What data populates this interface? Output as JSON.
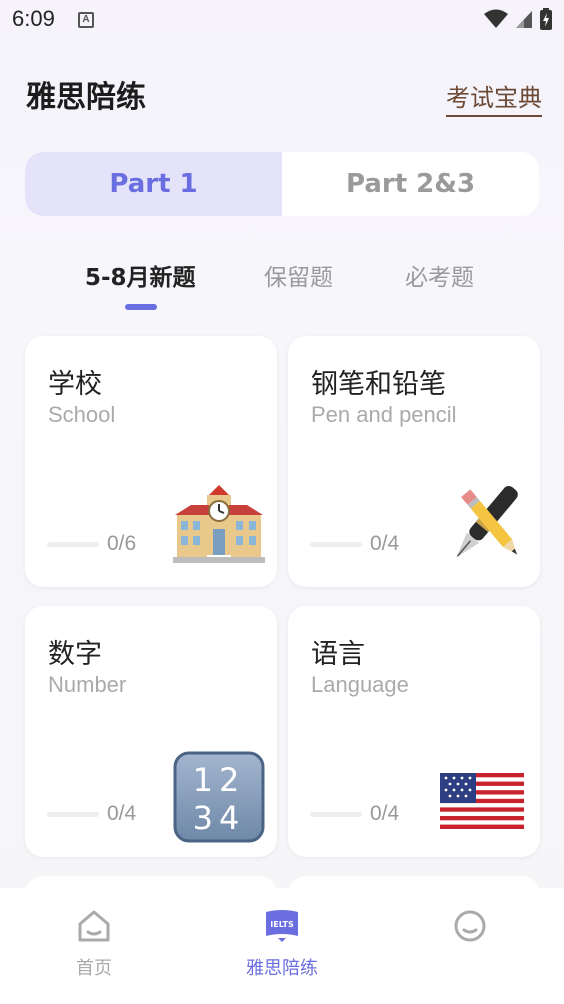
{
  "status_bar": {
    "time": "6:09",
    "notification_icon": "A"
  },
  "header": {
    "title": "雅思陪练",
    "link": "考试宝典"
  },
  "segment": {
    "tabs": [
      "Part 1",
      "Part 2&3"
    ],
    "selected": "Part 1"
  },
  "subtabs": {
    "items": [
      "5-8月新题",
      "保留题",
      "必考题"
    ],
    "selected": "5-8月新题"
  },
  "cards": [
    {
      "title": "学校",
      "subtitle": "School",
      "progress": "0/6",
      "icon": "school-building-icon"
    },
    {
      "title": "钢笔和铅笔",
      "subtitle": "Pen and pencil",
      "progress": "0/4",
      "icon": "pen-and-pencil-icon"
    },
    {
      "title": "数字",
      "subtitle": "Number",
      "progress": "0/4",
      "icon": "numbers-1234-icon",
      "icon_text": [
        "12",
        "34"
      ]
    },
    {
      "title": "语言",
      "subtitle": "Language",
      "progress": "0/4",
      "icon": "us-flag-icon"
    }
  ],
  "bottom_nav": {
    "items": [
      {
        "label": "首页",
        "icon": "home-icon"
      },
      {
        "label": "雅思陪练",
        "icon": "ielts-book-icon",
        "icon_text": "IELTS"
      },
      {
        "label": "",
        "icon": "profile-face-icon"
      }
    ],
    "selected": "雅思陪练"
  },
  "colors": {
    "accent": "#6a6ee0",
    "link": "#6d4a35",
    "segment_active_bg": "#e5e3fa"
  }
}
